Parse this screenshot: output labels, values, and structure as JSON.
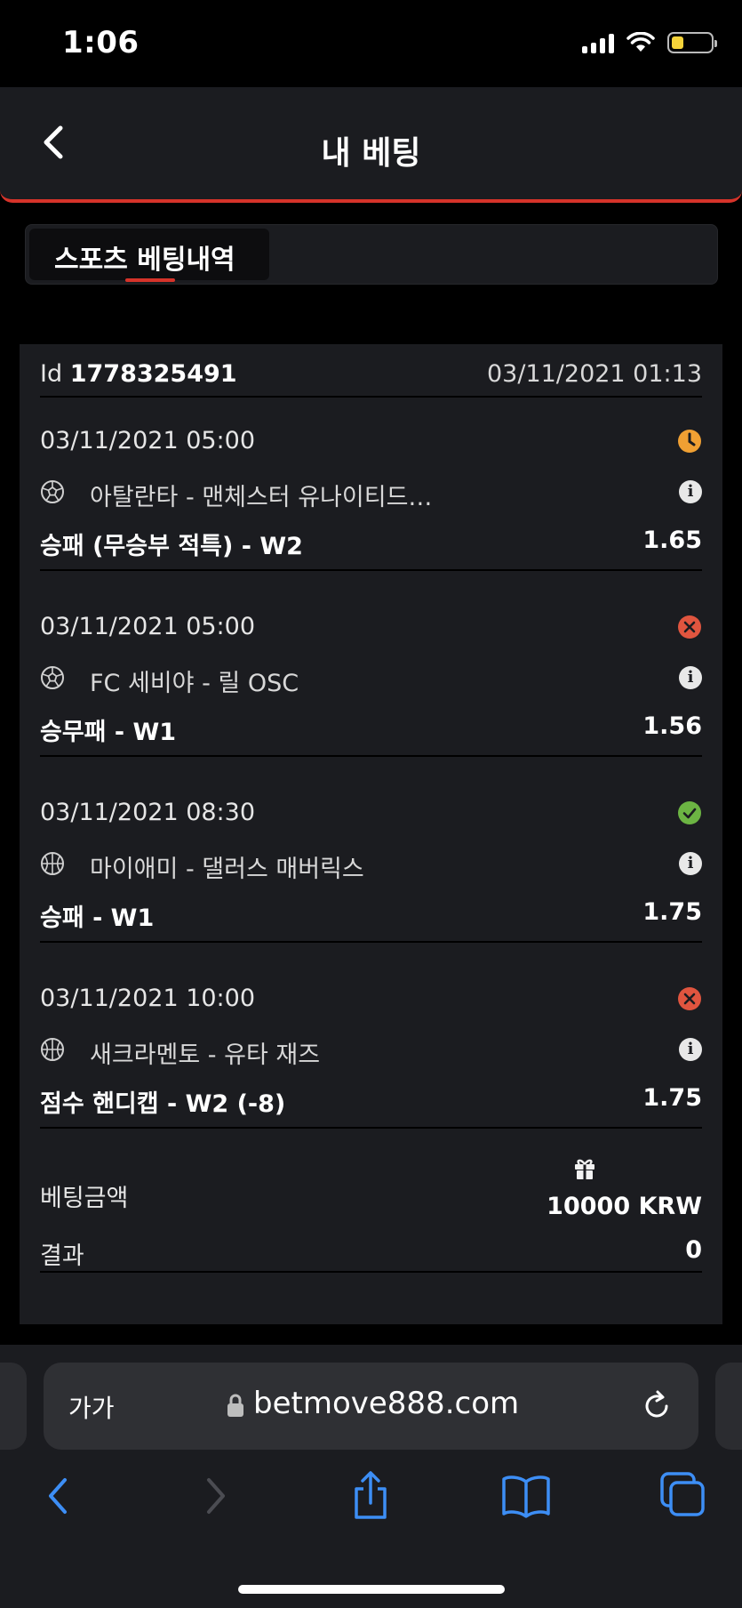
{
  "status_bar": {
    "time": "1:06",
    "battery_color": "#f5d33a"
  },
  "header": {
    "title": "내 베팅",
    "back_icon": "chevron-left-icon",
    "accent_color": "#d6332a"
  },
  "tabs": [
    {
      "label": "스포츠 베팅내역",
      "active": true
    }
  ],
  "bet": {
    "id_label": "Id",
    "id_value": "1778325491",
    "placed_at": "03/11/2021 01:13",
    "selections": [
      {
        "date": "03/11/2021 05:00",
        "status": "pending",
        "status_color": "#f0a033",
        "sport_icon": "soccer-ball-icon",
        "teams": "아탈란타 - 맨체스터 유나이티드…",
        "market": "승패 (무승부 적특) - W2",
        "odds": "1.65"
      },
      {
        "date": "03/11/2021 05:00",
        "status": "lost",
        "status_color": "#e0553f",
        "sport_icon": "soccer-ball-icon",
        "teams": "FC 세비야 - 릴 OSC",
        "market": "승무패 - W1",
        "odds": "1.56"
      },
      {
        "date": "03/11/2021 08:30",
        "status": "won",
        "status_color": "#6cb443",
        "sport_icon": "basketball-icon",
        "teams": "마이애미 - 댈러스 매버릭스",
        "market": "승패 - W1",
        "odds": "1.75"
      },
      {
        "date": "03/11/2021 10:00",
        "status": "lost",
        "status_color": "#e0553f",
        "sport_icon": "basketball-icon",
        "teams": "새크라멘토 - 유타 재즈",
        "market": "점수 핸디캡 - W2 (-8)",
        "odds": "1.75"
      }
    ],
    "amount_label": "베팅금액",
    "amount_value": "10000 KRW",
    "result_label": "결과",
    "result_value": "0"
  },
  "browser": {
    "aa_label": "가가",
    "url": "betmove888.com"
  }
}
